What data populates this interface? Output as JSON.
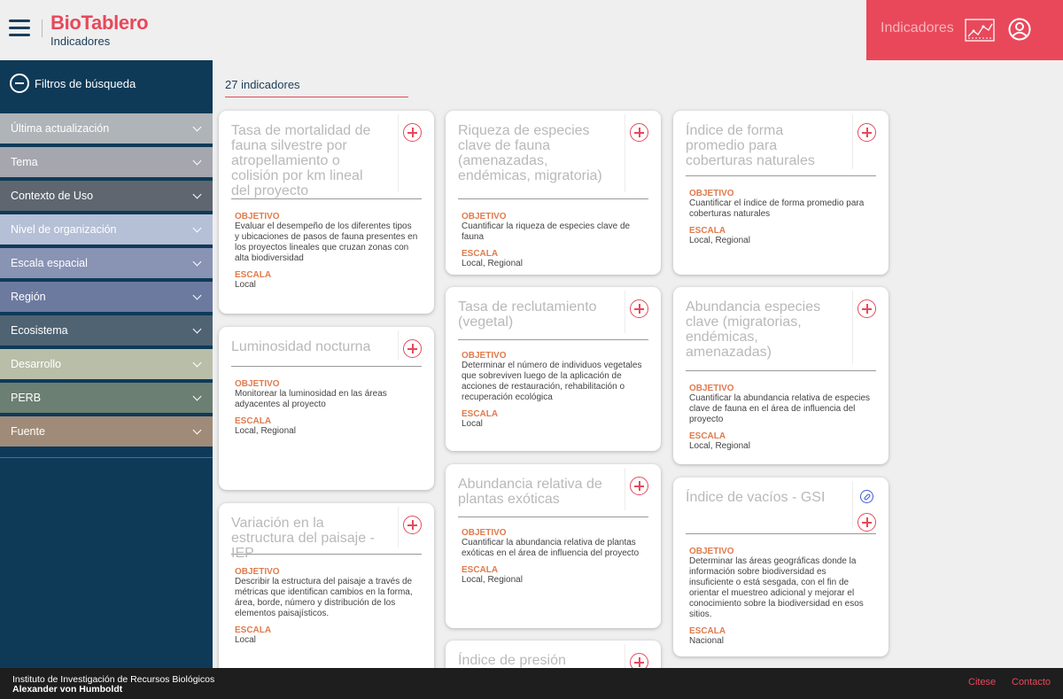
{
  "header": {
    "brand": "BioTablero",
    "subtitle": "Indicadores",
    "section_label": "Indicadores"
  },
  "sidebar": {
    "filters_title": "Filtros de búsqueda",
    "filters": [
      {
        "label": "Última actualización",
        "color": "#aeb4b8"
      },
      {
        "label": "Tema",
        "color": "#a5a6ae"
      },
      {
        "label": "Contexto de Uso",
        "color": "#5f6670"
      },
      {
        "label": "Nivel de organización",
        "color": "#b5bfd6"
      },
      {
        "label": "Escala espacial",
        "color": "#8993b4"
      },
      {
        "label": "Región",
        "color": "#6d7aa0"
      },
      {
        "label": "Ecosistema",
        "color": "#4f6373"
      },
      {
        "label": "Desarrollo",
        "color": "#b9bea8"
      },
      {
        "label": "PERB",
        "color": "#6c7f73"
      },
      {
        "label": "Fuente",
        "color": "#a08b79"
      }
    ]
  },
  "main": {
    "count_label": "27 indicadores",
    "objective_label": "OBJETIVO",
    "scale_label": "ESCALA",
    "cards": [
      {
        "title": "Tasa de mortalidad de fauna silvestre por atropellamiento o colisión por km lineal del proyecto",
        "objective": "Evaluar el desempeño de los diferentes tipos y ubicaciones de pasos de fauna presentes en los proyectos lineales que cruzan zonas con alta biodiversidad",
        "scale": "Local"
      },
      {
        "title": "Luminosidad nocturna",
        "objective": "Monitorear la luminosidad en las áreas adyacentes al proyecto",
        "scale": "Local, Regional"
      },
      {
        "title": "Variación en la estructura del paisaje - IEP",
        "objective": "Describir la estructura del paisaje a través de métricas que identifican cambios en la forma, área, borde, número y distribución de los elementos paisajísticos.",
        "scale": "Local"
      },
      {
        "title": "Riqueza de especies clave de fauna (amenazadas, endémicas, migratoria)",
        "objective": "Cuantificar la riqueza de especies clave de fauna",
        "scale": "Local, Regional"
      },
      {
        "title": "Tasa de reclutamiento (vegetal)",
        "objective": "Determinar el número de individuos vegetales que sobreviven luego de la aplicación de acciones de restauración, rehabilitación o recuperación ecológica",
        "scale": "Local"
      },
      {
        "title": "Abundancia relativa de plantas exóticas",
        "objective": "Cuantificar la abundancia relativa de plantas exóticas en el área de influencia del proyecto",
        "scale": "Local, Regional"
      },
      {
        "title": "Índice de presión",
        "objective": "",
        "scale": ""
      },
      {
        "title": "Índice de forma promedio para coberturas naturales",
        "objective": "Cuantificar el índice de forma promedio para coberturas naturales",
        "scale": "Local, Regional"
      },
      {
        "title": "Abundancia especies clave (migratorias, endémicas, amenazadas)",
        "objective": "Cuantificar la abundancia relativa de especies clave de fauna en el área de influencia del proyecto",
        "scale": "Local, Regional"
      },
      {
        "title": "Índice de vacíos - GSI",
        "objective": "Determinar las áreas geográficas donde la información sobre biodiversidad es insuficiente o está sesgada, con el fin de orientar el muestreo adicional y mejorar el conocimiento sobre la biodiversidad en esos sitios.",
        "scale": "Nacional"
      }
    ]
  },
  "footer": {
    "institute_line1": "Instituto de Investigación de Recursos Biológicos",
    "institute_line2": "Alexander von Humboldt",
    "cite_label": "Citese",
    "contact_label": "Contacto"
  },
  "colors": {
    "accent": "#e8485a",
    "sidebar_bg": "#0e3a58",
    "section_label": "#e07b4d"
  }
}
